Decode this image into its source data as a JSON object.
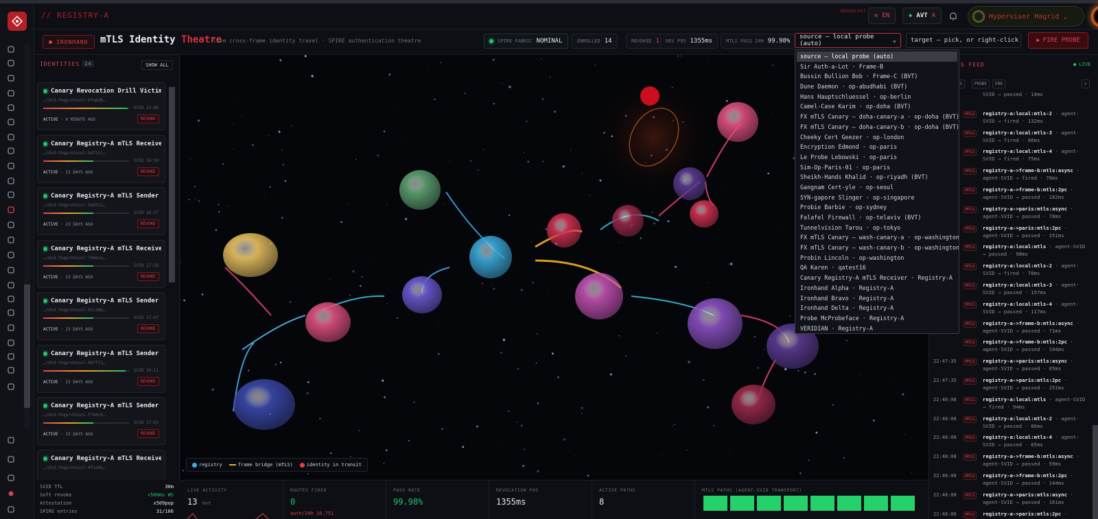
{
  "brand": "// REGISTRY-A",
  "header": {
    "broadcast_label": "BROADCAST",
    "lang_label": "EN",
    "avt_label": "AVT",
    "avt_suffix": "A",
    "user_name": "Hypervisor Hagrid"
  },
  "titlebar": {
    "tenant_badge": "IRONHAND",
    "title_main": "mTLS Identity",
    "title_accent": "Theatre",
    "subtitle": "live cross-frame identity travel · SPIRE authentication theatre",
    "stats": {
      "spire_label": "SPIRE FABRIC",
      "spire_value": "NOMINAL",
      "enrolled_label": "ENROLLED",
      "enrolled_value": "14",
      "revoked_label": "REVOKED",
      "revoked_value": "1",
      "rev_label": "REV P95",
      "rev_value": "1355ms",
      "pass_label": "MTLS PASS 24H",
      "pass_value": "99.98%"
    },
    "source_select_value": "source — local probe (auto)",
    "target_select_value": "target — pick, or right-click a r",
    "fire_label": "FIRE PROBE"
  },
  "identities": {
    "heading": "IDENTITIES",
    "count": "14",
    "show_all_label": "SHOW ALL",
    "cards": [
      {
        "name": "Canary Revocation Drill Victim",
        "did": "…/did-thqprotocol-bfa6d8…",
        "svid": "SVID 23:06",
        "state": "ACTIVE",
        "age": "A MINUTE AGO",
        "revoke": "REVOKE",
        "fill": 0.98
      },
      {
        "name": "Canary Registry-A mTLS Receiver…",
        "did": "…/did-thqprotocol-b6712c…",
        "svid": "SVID 16:59",
        "state": "ACTIVE",
        "age": "23 DAYS AGO",
        "revoke": "REVOKE",
        "fill": 0.58
      },
      {
        "name": "Canary Registry-A mTLS Sender 2",
        "did": "…/did-thqprotocol-5eb511…",
        "svid": "SVID 16:57",
        "state": "ACTIVE",
        "age": "23 DAYS AGO",
        "revoke": "REVOKE",
        "fill": 0.58
      },
      {
        "name": "Canary Registry-A mTLS Receiver…",
        "did": "…/did-thqprotocol-7d0ece…",
        "svid": "SVID 17:18",
        "state": "ACTIVE",
        "age": "23 DAYS AGO",
        "revoke": "REVOKE",
        "fill": 0.58
      },
      {
        "name": "Canary Registry-A mTLS Sender 4",
        "did": "…/did-thqprotocol-b1c386…",
        "svid": "SVID 17:07",
        "state": "ACTIVE",
        "age": "23 DAYS AGO",
        "revoke": "REVOKE",
        "fill": 0.58
      },
      {
        "name": "Canary Registry-A mTLS Sender",
        "did": "…/did-thqprotocol-86ff71…",
        "svid": "SVID 20:11",
        "state": "ACTIVE",
        "age": "23 DAYS AGO",
        "revoke": "REVOKE",
        "fill": 0.96
      },
      {
        "name": "Canary Registry-A mTLS Sender 3",
        "did": "…/did-thqprotocol-f74dc9…",
        "svid": "SVID 17:02",
        "state": "ACTIVE",
        "age": "23 DAYS AGO",
        "revoke": "REVOKE",
        "fill": 0.58
      },
      {
        "name": "Canary Registry-A mTLS Receiver",
        "did": "…/did-thqprotocol-4f1284…",
        "svid": "",
        "state": "",
        "age": "",
        "revoke": "",
        "fill": 0
      }
    ]
  },
  "left_stats": [
    {
      "label": "SVID TTL",
      "value": "30m"
    },
    {
      "label": "Soft revoke",
      "value": "<500ms WS"
    },
    {
      "label": "Attestation",
      "value": "x509pop"
    },
    {
      "label": "SPIRE entries",
      "value": "31/106"
    }
  ],
  "legend": {
    "registry": "registry",
    "bridge": "frame bridge (mTLS)",
    "transit": "identity in transit"
  },
  "dropdown_options": [
    "source — local probe (auto)",
    "Sir Auth-a-Lot · Frame-B",
    "Bussin Bullion Bob · Frame-C (BVT)",
    "Dune Daemon · op-abudhabi (BVT)",
    "Hans Hauptschluessel · op-berlin",
    "Camel-Case Karim · op-doha (BVT)",
    "FX mTLS Canary — doha-canary-a · op-doha (BVT)",
    "FX mTLS Canary — doha-canary-b · op-doha (BVT)",
    "Cheeky Cert Geezer · op-london",
    "Encryption Edmond · op-paris",
    "Le Probe Lebowski · op-paris",
    "Sim-Op-Paris-01 · op-paris",
    "Sheikh-Hands Khalid · op-riyadh (BVT)",
    "Gangnam Cert-yle · op-seoul",
    "SYN-gapore Slinger · op-singapore",
    "Probie Barbie · op-sydney",
    "Falafel Firewall · op-telaviv (BVT)",
    "Tunnelvision Tarou · op-tokyo",
    "FX mTLS Canary — wash-canary-a · op-washington",
    "FX mTLS Canary — wash-canary-b · op-washington",
    "Probin Lincoln · op-washington",
    "QA Karen · qatest16",
    "Canary Registry-A mTLS Receiver · Registry-A",
    "Ironhand Alpha · Registry-A",
    "Ironhand Bravo · Registry-A",
    "Ironhand Delta · Registry-A",
    "Probe McProbeface · Registry-A",
    "VERIDIAN · Registry-A"
  ],
  "feed": {
    "heading": "LS FEED",
    "live_label": "LIVE",
    "tabs": [
      "ILS",
      "PROBE",
      "ERR"
    ],
    "rows": [
      {
        "time": "",
        "tag": "",
        "text_bold": "",
        "text": "SVID → passed · 14ms"
      },
      {
        "time": "",
        "tag": "MTLS",
        "text_bold": "registry-a:local:mtls-2",
        "text": " · agent-SVID → fired · 132ms"
      },
      {
        "time": "",
        "tag": "MTLS",
        "text_bold": "registry-a:local:mtls-3",
        "text": " · agent-SVID → fired · 66ms"
      },
      {
        "time": "",
        "tag": "MTLS",
        "text_bold": "registry-a:local:mtls-4",
        "text": " · agent-SVID → fired · 75ms"
      },
      {
        "time": "",
        "tag": "MTLS",
        "text_bold": "registry-a->frame-b:mtls:async",
        "text": " · agent-SVID → fired · 76ms"
      },
      {
        "time": "",
        "tag": "MTLS",
        "text_bold": "registry-a->frame-b:mtls:2pc",
        "text": " · agent-SVID → passed · 182ms"
      },
      {
        "time": "",
        "tag": "MTLS",
        "text_bold": "registry-a->paris:mtls:async",
        "text": " · agent-SVID → passed · 78ms"
      },
      {
        "time": "",
        "tag": "MTLS",
        "text_bold": "registry-a->paris:mtls:2pc",
        "text": " · agent-SVID → passed · 151ms"
      },
      {
        "time": "",
        "tag": "MTLS",
        "text_bold": "registry-a:local:mtls",
        "text": " · agent-SVID → passed · 98ms"
      },
      {
        "time": "",
        "tag": "MTLS",
        "text_bold": "registry-a:local:mtls-2",
        "text": " · agent-SVID → fired · 70ms"
      },
      {
        "time": "",
        "tag": "MTLS",
        "text_bold": "registry-a:local:mtls-3",
        "text": " · agent-SVID → passed · 197ms"
      },
      {
        "time": "",
        "tag": "MTLS",
        "text_bold": "registry-a:local:mtls-4",
        "text": " · agent-SVID → passed · 117ms"
      },
      {
        "time": "",
        "tag": "MTLS",
        "text_bold": "registry-a->frame-b:mtls:async",
        "text": " · agent-SVID → passed · 71ms"
      },
      {
        "time": "",
        "tag": "MTLS",
        "text_bold": "registry-a->frame-b:mtls:2pc",
        "text": " · agent-SVID → passed · 194ms"
      },
      {
        "time": "22:47:35",
        "tag": "MTLS",
        "text_bold": "registry-a->paris:mtls:async",
        "text": " · agent-SVID → passed · 65ms"
      },
      {
        "time": "22:47:35",
        "tag": "MTLS",
        "text_bold": "registry-a->paris:mtls:2pc",
        "text": " · agent-SVID → passed · 151ms"
      },
      {
        "time": "22:48:08",
        "tag": "MTLS",
        "text_bold": "registry-a:local:mtls",
        "text": " · agent-SVID → fired · 94ms"
      },
      {
        "time": "22:48:08",
        "tag": "MTLS",
        "text_bold": "registry-a:local:mtls-2",
        "text": " · agent-SVID → passed · 86ms"
      },
      {
        "time": "22:48:08",
        "tag": "MTLS",
        "text_bold": "registry-a:local:mtls-4",
        "text": " · agent-SVID → passed · 65ms"
      },
      {
        "time": "22:48:08",
        "tag": "MTLS",
        "text_bold": "registry-a->frame-b:mtls:async",
        "text": " · agent-SVID → passed · 59ms"
      },
      {
        "time": "22:48:08",
        "tag": "MTLS",
        "text_bold": "registry-a->frame-b:mtls:2pc",
        "text": " · agent-SVID → passed · 144ms"
      },
      {
        "time": "22:48:08",
        "tag": "MTLS",
        "text_bold": "registry-a->paris:mtls:async",
        "text": " · agent-SVID → passed · 161ms"
      },
      {
        "time": "22:48:08",
        "tag": "MTLS",
        "text_bold": "registry-a->paris:mtls:2pc",
        "text": " · agent-SVID → passed · 145ms"
      }
    ]
  },
  "bottom": {
    "live_label": "LIVE ACTIVITY",
    "live_value": "13",
    "live_unit": "evt",
    "routes_label": "ROUTES FIRED",
    "routes_value": "0",
    "routes_sub": "auth/24h 10,751",
    "pass_label": "PASS RATE",
    "pass_value": "99.98%",
    "rev_label": "REVOCATION P95",
    "rev_value": "1355ms",
    "paths_label": "ACTIVE PATHS",
    "paths_value": "8",
    "mtls_label": "MTLS PATHS (AGENT-SVID TRANSPORT)",
    "mtls_paths_count": 8
  },
  "colors": {
    "accent": "#e0303c",
    "ok": "#25c26a",
    "bridge": "#f0b020"
  }
}
